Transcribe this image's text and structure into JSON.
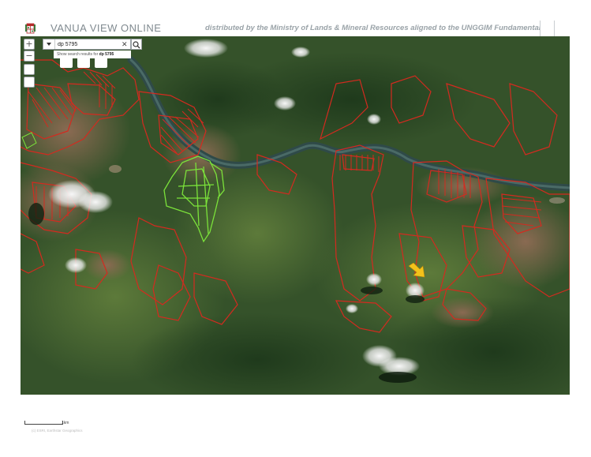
{
  "header": {
    "app_title": "VANUA VIEW ONLINE",
    "subtitle": "distributed by the Ministry of Lands & Mineral Resources aligned to the UNGGIM Fundamental Da"
  },
  "search": {
    "value": "dp 5795",
    "suggestion_prefix": "Show search results for ",
    "suggestion_term": "dp 5795"
  },
  "controls": {
    "zoom_in": "+",
    "zoom_out": "−"
  },
  "scale": {
    "label": "1km",
    "attribution": "(c) ESRI, Earthstar Geographics"
  },
  "icons": {
    "logo": "fiji-coat-of-arms-icon",
    "search": "search-icon",
    "clear": "close-icon",
    "marker": "arrow-marker-icon"
  },
  "colors": {
    "parcel_outline": "#d42a1f",
    "selected_parcel": "#7be23a",
    "marker": "#f3c21b",
    "river": "#2f4a48"
  }
}
